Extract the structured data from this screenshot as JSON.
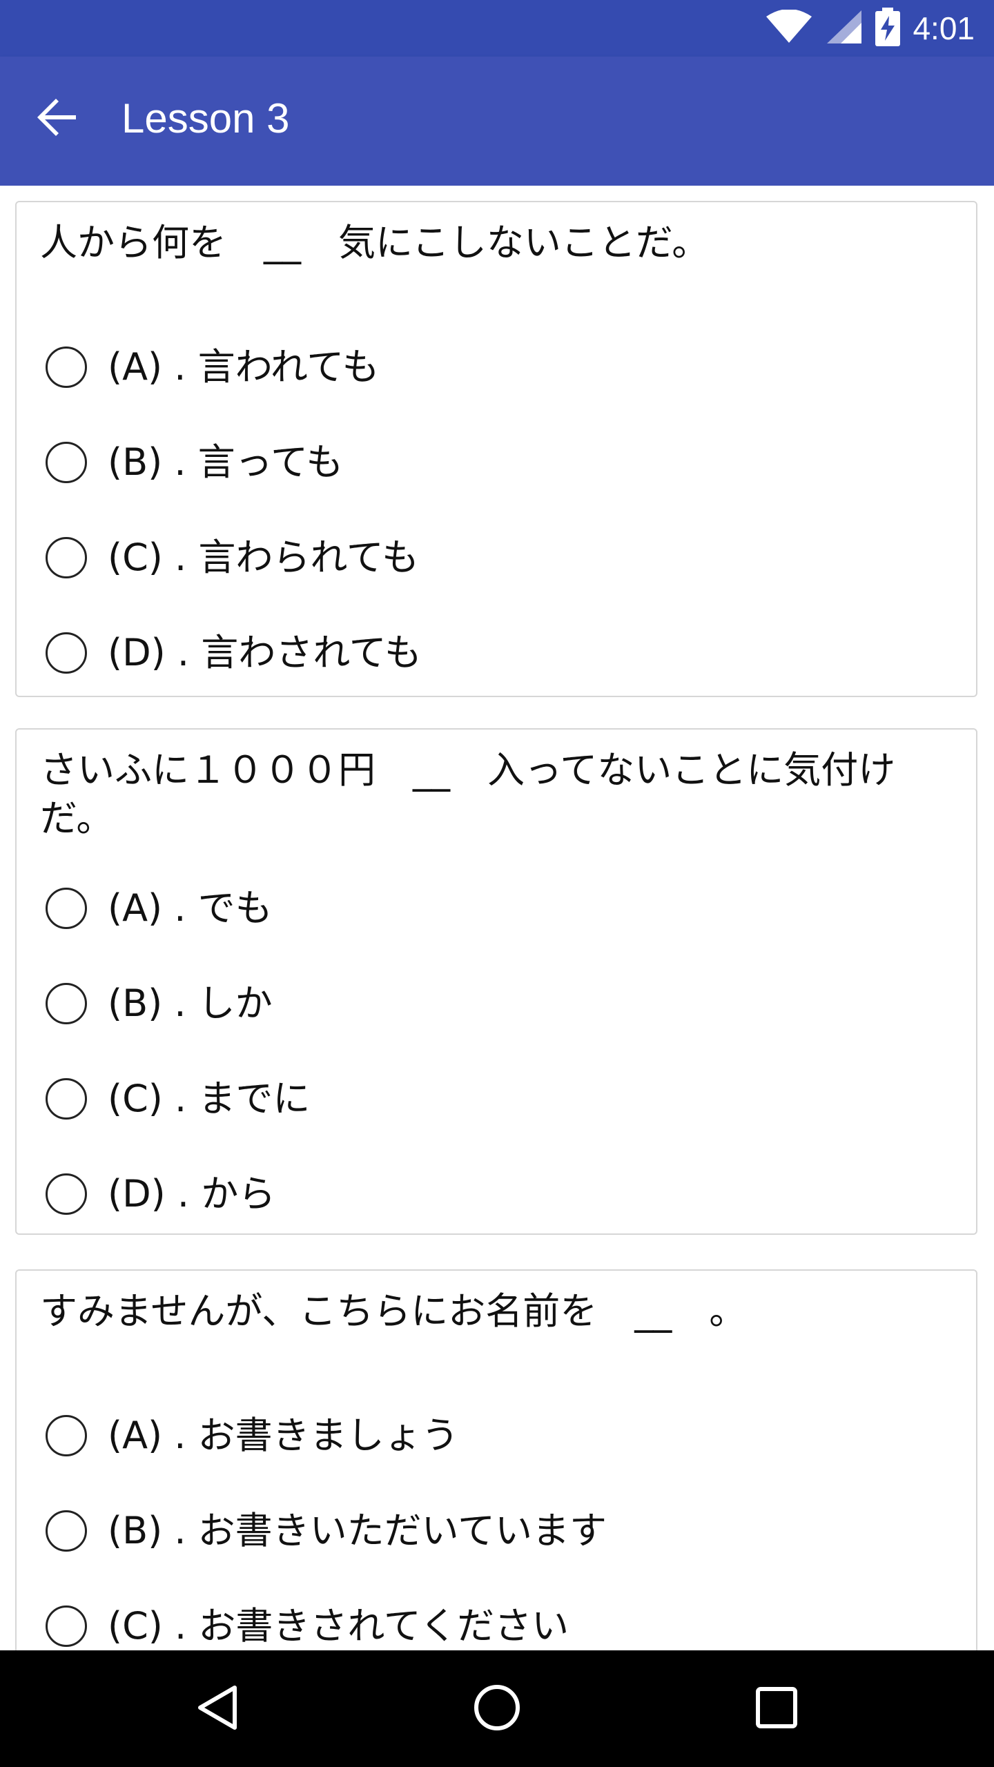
{
  "status_bar": {
    "time": "4:01",
    "icons": [
      "wifi-icon",
      "signal-icon",
      "battery-charging-icon"
    ]
  },
  "app_bar": {
    "title": "Lesson 3",
    "back_icon": "arrow-back-icon"
  },
  "questions": [
    {
      "text": "人から何を　__　気にこしないことだ。",
      "options": [
        "(A) . 言われても",
        "(B) . 言っても",
        "(C) . 言わられても",
        "(D) . 言わされても"
      ]
    },
    {
      "text": "さいふに１０００円　__　入ってないことに気付けだ。",
      "options": [
        "(A) . でも",
        "(B) . しか",
        "(C) . までに",
        "(D) . から"
      ]
    },
    {
      "text": "すみませんが、こちらにお名前を　__　。",
      "options": [
        "(A) . お書きましょう",
        "(B) . お書きいただいています",
        "(C) . お書きされてください"
      ]
    }
  ],
  "nav_bar": {
    "icons": [
      "back-triangle-icon",
      "home-circle-icon",
      "recents-square-icon"
    ]
  },
  "colors": {
    "status_bar": "#354BB0",
    "app_bar": "#3F51B5",
    "nav_bar": "#000000",
    "card_border": "#d6d6d6"
  }
}
